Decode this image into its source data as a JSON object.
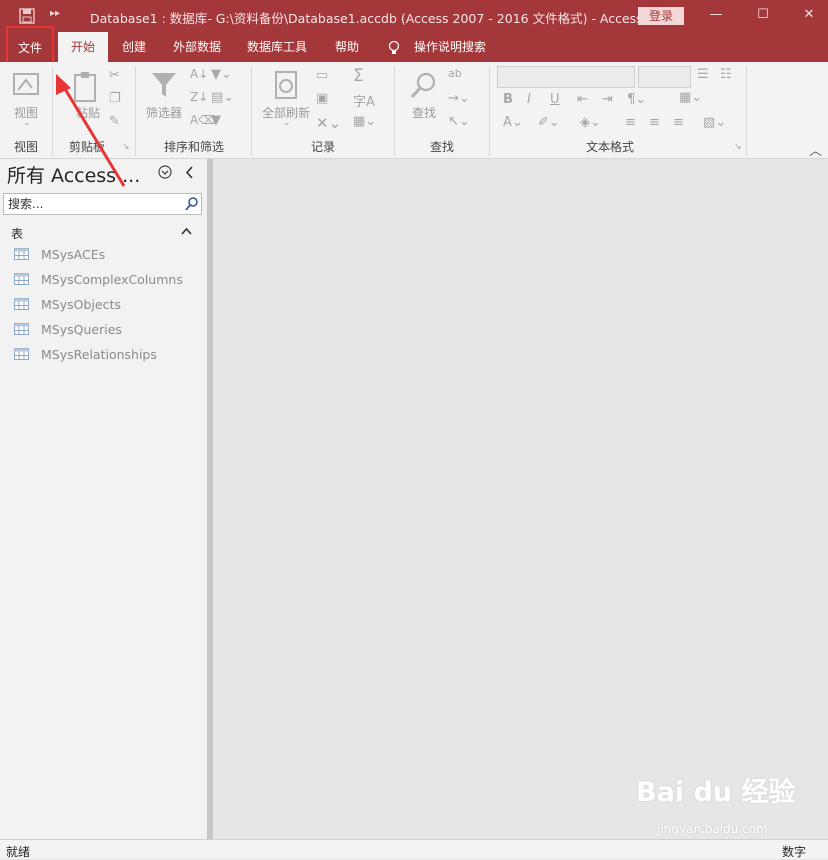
{
  "titlebar": {
    "title": "Database1 : 数据库- G:\\资料备份\\Database1.accdb (Access 2007 - 2016 文件格式)  -  Access",
    "login": "登录",
    "minimize": "—",
    "maximize": "☐",
    "close": "✕"
  },
  "tabs": {
    "file": "文件",
    "home": "开始",
    "create": "创建",
    "external": "外部数据",
    "dbtools": "数据库工具",
    "help": "帮助",
    "tellme": "操作说明搜索"
  },
  "ribbon": {
    "view_label": "视图",
    "paste_label": "粘贴",
    "filter_label": "筛选器",
    "refresh_label": "全部刷新",
    "find_label": "查找",
    "groups": {
      "view": "视图",
      "clipboard": "剪贴板",
      "sort_filter": "排序和筛选",
      "records": "记录",
      "find": "查找",
      "text_format": "文本格式"
    }
  },
  "navpane": {
    "title": "所有 Access ...",
    "search_placeholder": "搜索...",
    "group_header": "表",
    "items": [
      {
        "label": "MSysACEs"
      },
      {
        "label": "MSysComplexColumns"
      },
      {
        "label": "MSysObjects"
      },
      {
        "label": "MSysQueries"
      },
      {
        "label": "MSysRelationships"
      }
    ]
  },
  "statusbar": {
    "left": "就绪",
    "right": "数字"
  },
  "watermark": {
    "brand": "Bai du 经验",
    "url": "jingyan.baidu.com"
  },
  "colors": {
    "accent": "#a4373a",
    "highlight": "#e53535"
  }
}
